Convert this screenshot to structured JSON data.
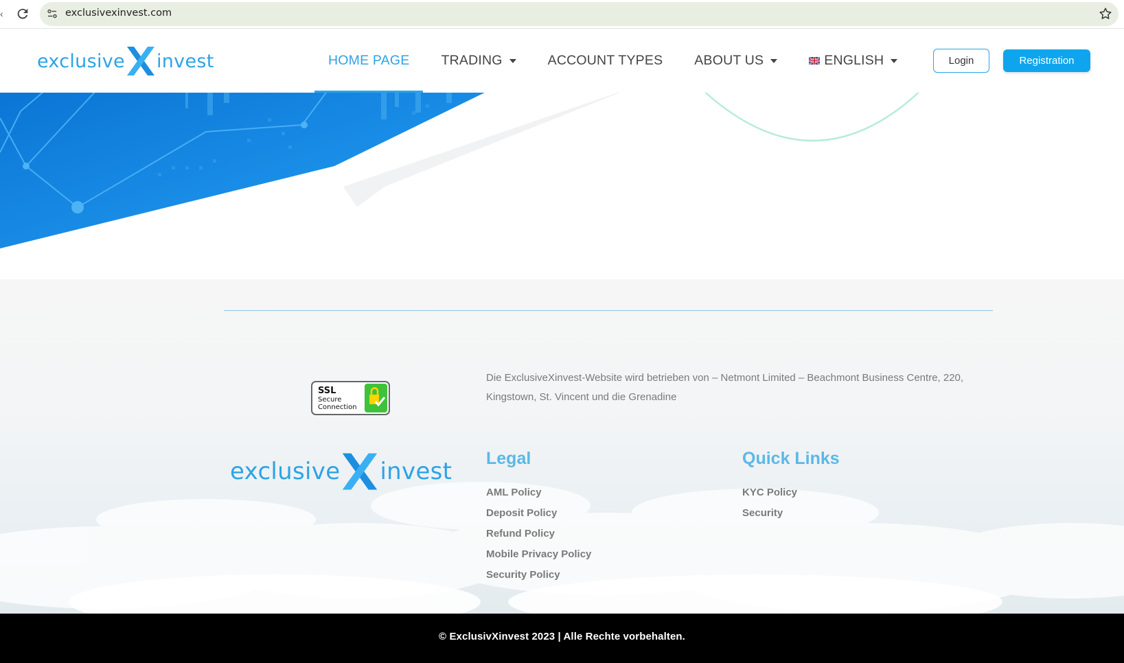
{
  "browser": {
    "url": "exclusivexinvest.com"
  },
  "header": {
    "logo": {
      "left": "exclusive",
      "mid": "X",
      "right": "invest"
    },
    "nav": [
      {
        "label": "HOME PAGE",
        "has_dropdown": false,
        "active": true
      },
      {
        "label": "TRADING",
        "has_dropdown": true,
        "active": false
      },
      {
        "label": "ACCOUNT TYPES",
        "has_dropdown": false,
        "active": false
      },
      {
        "label": "ABOUT US",
        "has_dropdown": true,
        "active": false
      },
      {
        "label": "ENGLISH",
        "has_dropdown": true,
        "active": false,
        "icon": "uk-flag-icon"
      }
    ],
    "login_label": "Login",
    "register_label": "Registration"
  },
  "footer": {
    "ssl_badge": {
      "line1": "SSL",
      "line2": "Secure",
      "line3": "Connection"
    },
    "address": "Die ExclusiveXinvest-Website wird betrieben von – Netmont Limited – Beachmont Business Centre, 220, Kingstown, St. Vincent und die Grenadine",
    "legal": {
      "title": "Legal",
      "links": [
        "AML Policy",
        "Deposit Policy",
        "Refund Policy",
        "Mobile Privacy Policy",
        "Security Policy"
      ]
    },
    "quick_links": {
      "title": "Quick Links",
      "links": [
        "KYC Policy",
        "Security"
      ]
    },
    "copyright": "©  ExclusivXinvest 2023 | Alle Rechte vorbehalten."
  },
  "colors": {
    "brand_blue": "#2ea3e6",
    "register_button": "#0fa5ee",
    "footer_heading": "#5cb8e6",
    "footer_text": "#7a7a7a",
    "bottom_bar": "#000000"
  }
}
